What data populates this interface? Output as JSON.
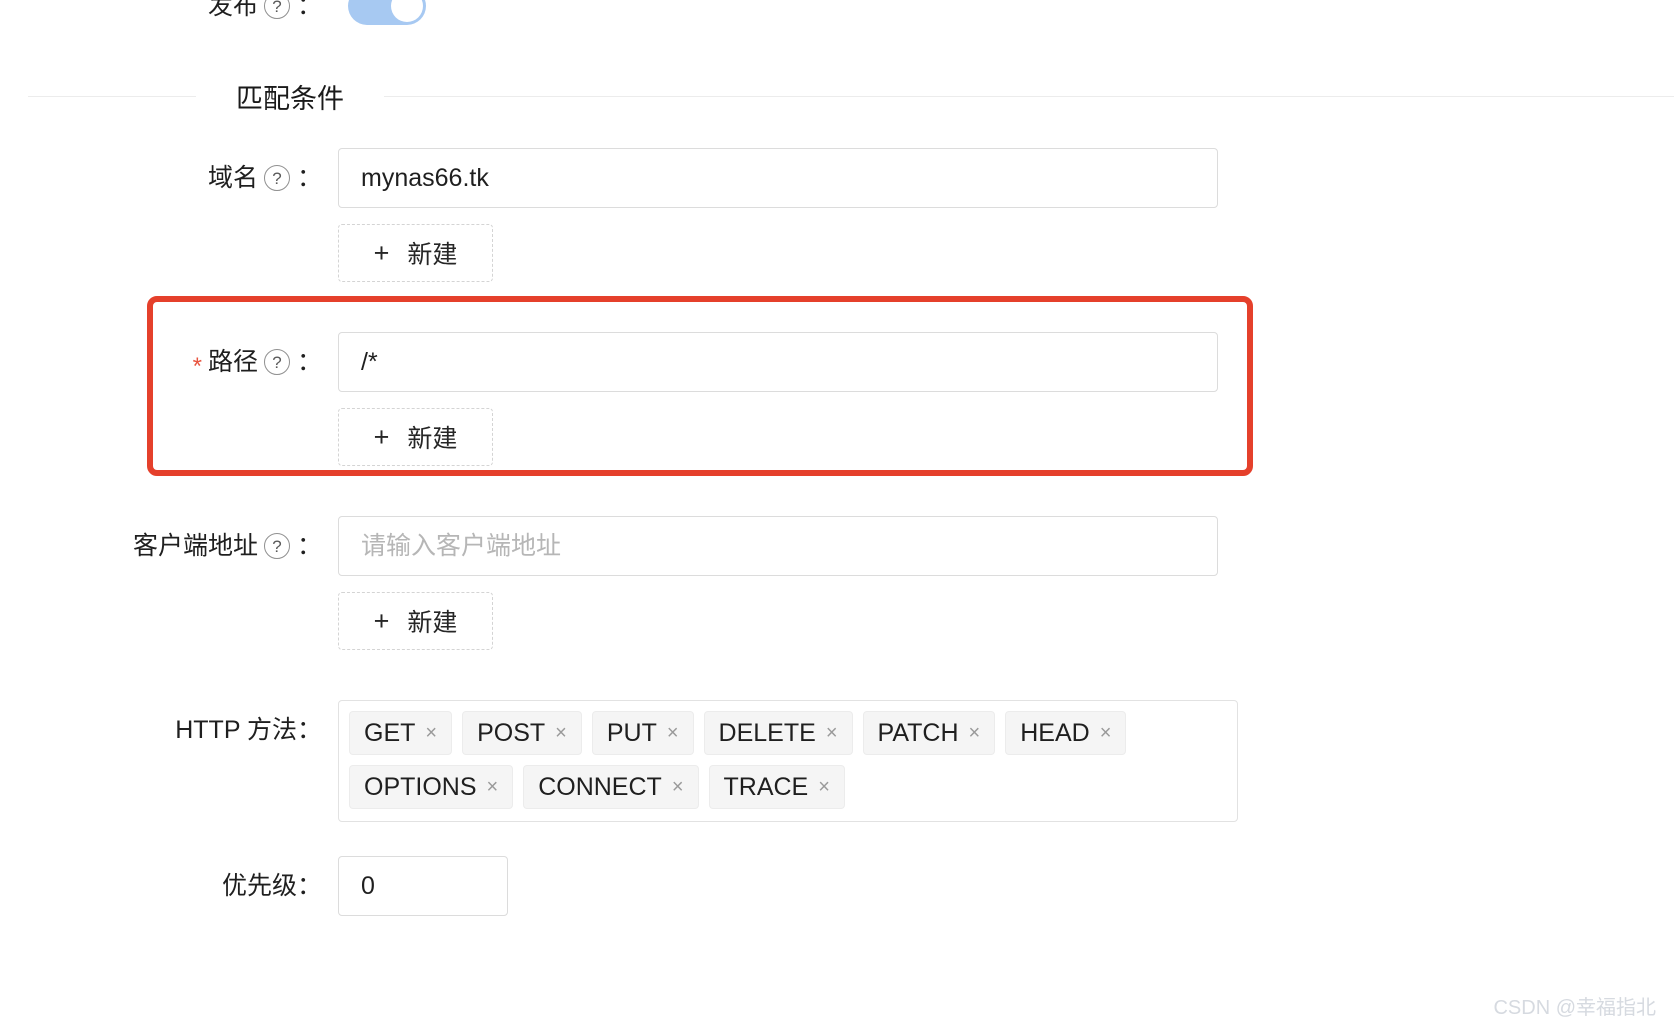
{
  "publish": {
    "label": "发布",
    "help_icon": "question-circle-icon",
    "colon": "：",
    "toggle_on": true,
    "toggle_color": "#a7c9f2"
  },
  "section": {
    "title": "匹配条件"
  },
  "fields": {
    "domain": {
      "label": "域名",
      "help_icon": "question-circle-icon",
      "colon": "：",
      "value": "mynas66.tk",
      "new_button": "新建",
      "plus_icon": "plus-icon"
    },
    "path": {
      "required_marker": "*",
      "label": "路径",
      "help_icon": "question-circle-icon",
      "colon": "：",
      "value": "/*",
      "new_button": "新建",
      "plus_icon": "plus-icon",
      "highlight_color": "#e5402b"
    },
    "client_address": {
      "label": "客户端地址",
      "help_icon": "question-circle-icon",
      "colon": "：",
      "value": "",
      "placeholder": "请输入客户端地址",
      "new_button": "新建",
      "plus_icon": "plus-icon"
    },
    "http_methods": {
      "label": "HTTP 方法：",
      "tags": [
        {
          "name": "GET",
          "remove_icon": "×"
        },
        {
          "name": "POST",
          "remove_icon": "×"
        },
        {
          "name": "PUT",
          "remove_icon": "×"
        },
        {
          "name": "DELETE",
          "remove_icon": "×"
        },
        {
          "name": "PATCH",
          "remove_icon": "×"
        },
        {
          "name": "HEAD",
          "remove_icon": "×"
        },
        {
          "name": "OPTIONS",
          "remove_icon": "×"
        },
        {
          "name": "CONNECT",
          "remove_icon": "×"
        },
        {
          "name": "TRACE",
          "remove_icon": "×"
        }
      ]
    },
    "priority": {
      "label": "优先级：",
      "value": "0"
    }
  },
  "watermark": {
    "text": "CSDN @幸福指北"
  }
}
